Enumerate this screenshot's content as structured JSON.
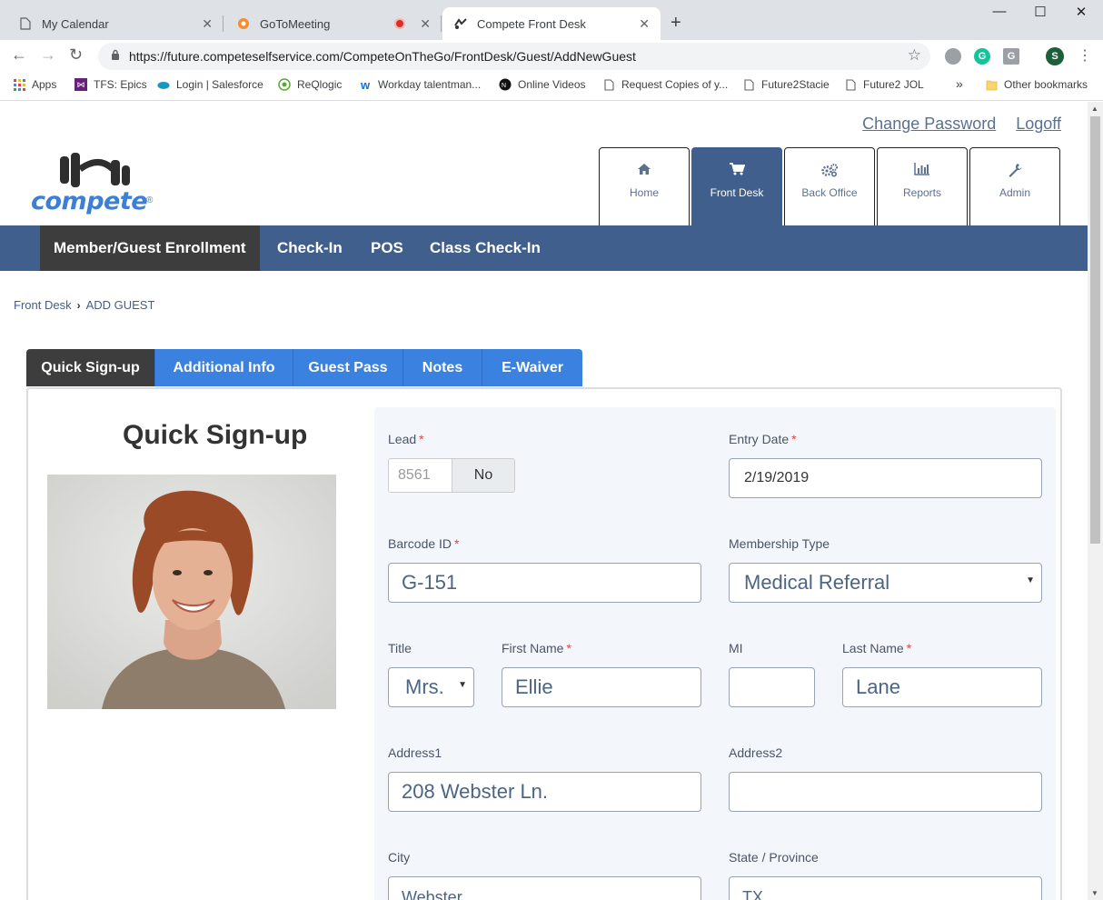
{
  "browser": {
    "tabs": [
      {
        "title": "My Calendar",
        "icon": "document-icon"
      },
      {
        "title": "GoToMeeting",
        "icon": "gotomeeting-icon",
        "recording": true
      },
      {
        "title": "Compete Front Desk",
        "icon": "compete-icon",
        "active": true
      }
    ],
    "url": "https://future.competeselfservice.com/CompeteOnTheGo/FrontDesk/Guest/AddNewGuest",
    "extensions": [
      {
        "name": "extension-circle-icon",
        "label": "",
        "color": "#9aa0a6"
      },
      {
        "name": "grammarly-icon",
        "label": "G",
        "color": "#15c39a"
      },
      {
        "name": "extension-g-icon",
        "label": "G",
        "color": "#9aa0a6"
      },
      {
        "name": "profile-avatar",
        "label": "S",
        "color": "#1e5e3a"
      }
    ],
    "bookmarks": [
      {
        "label": "Apps",
        "icon": "apps-grid-icon"
      },
      {
        "label": "TFS: Epics",
        "icon": "visual-studio-icon"
      },
      {
        "label": "Login | Salesforce",
        "icon": "salesforce-cloud-icon"
      },
      {
        "label": "ReQlogic",
        "icon": "reqlogic-icon"
      },
      {
        "label": "Workday talentman...",
        "icon": "workday-icon"
      },
      {
        "label": "Online Videos",
        "icon": "video-icon"
      },
      {
        "label": "Request Copies of y...",
        "icon": "document-icon"
      },
      {
        "label": "Future2Stacie",
        "icon": "document-icon"
      },
      {
        "label": "Future2 JOL",
        "icon": "document-icon"
      }
    ],
    "bookmarks_more": "»",
    "other_bookmarks": "Other bookmarks"
  },
  "header": {
    "change_password": "Change Password",
    "logoff": "Logoff",
    "logo_text": "compete",
    "main_tabs": [
      {
        "label": "Home",
        "icon": "home-icon"
      },
      {
        "label": "Front Desk",
        "icon": "cart-icon",
        "active": true
      },
      {
        "label": "Back Office",
        "icon": "gears-icon"
      },
      {
        "label": "Reports",
        "icon": "bar-chart-icon"
      },
      {
        "label": "Admin",
        "icon": "wrench-icon"
      }
    ]
  },
  "subnav": {
    "items": [
      {
        "label": "Member/Guest Enrollment",
        "active": true
      },
      {
        "label": "Check-In"
      },
      {
        "label": "POS"
      },
      {
        "label": "Class Check-In"
      }
    ]
  },
  "breadcrumb": {
    "parent": "Front Desk",
    "current": "ADD GUEST"
  },
  "form_tabs": [
    {
      "label": "Quick Sign-up",
      "active": true
    },
    {
      "label": "Additional Info"
    },
    {
      "label": "Guest Pass"
    },
    {
      "label": "Notes"
    },
    {
      "label": "E-Waiver"
    }
  ],
  "quick_signup": {
    "title": "Quick Sign-up",
    "fields": {
      "lead": {
        "label": "Lead",
        "required": "*",
        "number": "8561",
        "value": "No"
      },
      "entry_date": {
        "label": "Entry Date",
        "required": "*",
        "value": "2/19/2019"
      },
      "barcode_id": {
        "label": "Barcode ID",
        "required": "*",
        "value": "G-151"
      },
      "membership_type": {
        "label": "Membership Type",
        "value": "Medical Referral"
      },
      "title": {
        "label": "Title",
        "value": "Mrs."
      },
      "first_name": {
        "label": "First Name",
        "required": "*",
        "value": "Ellie"
      },
      "mi": {
        "label": "MI",
        "value": ""
      },
      "last_name": {
        "label": "Last Name",
        "required": "*",
        "value": "Lane"
      },
      "address1": {
        "label": "Address1",
        "value": "208 Webster Ln."
      },
      "address2": {
        "label": "Address2",
        "value": ""
      },
      "city": {
        "label": "City",
        "value": "Webster"
      },
      "state": {
        "label": "State / Province",
        "value": "TX"
      }
    }
  },
  "colors": {
    "brand": "#405f8c",
    "tab_blue": "#3b82e0",
    "dark": "#3d3d3d",
    "required": "#e0434d"
  }
}
